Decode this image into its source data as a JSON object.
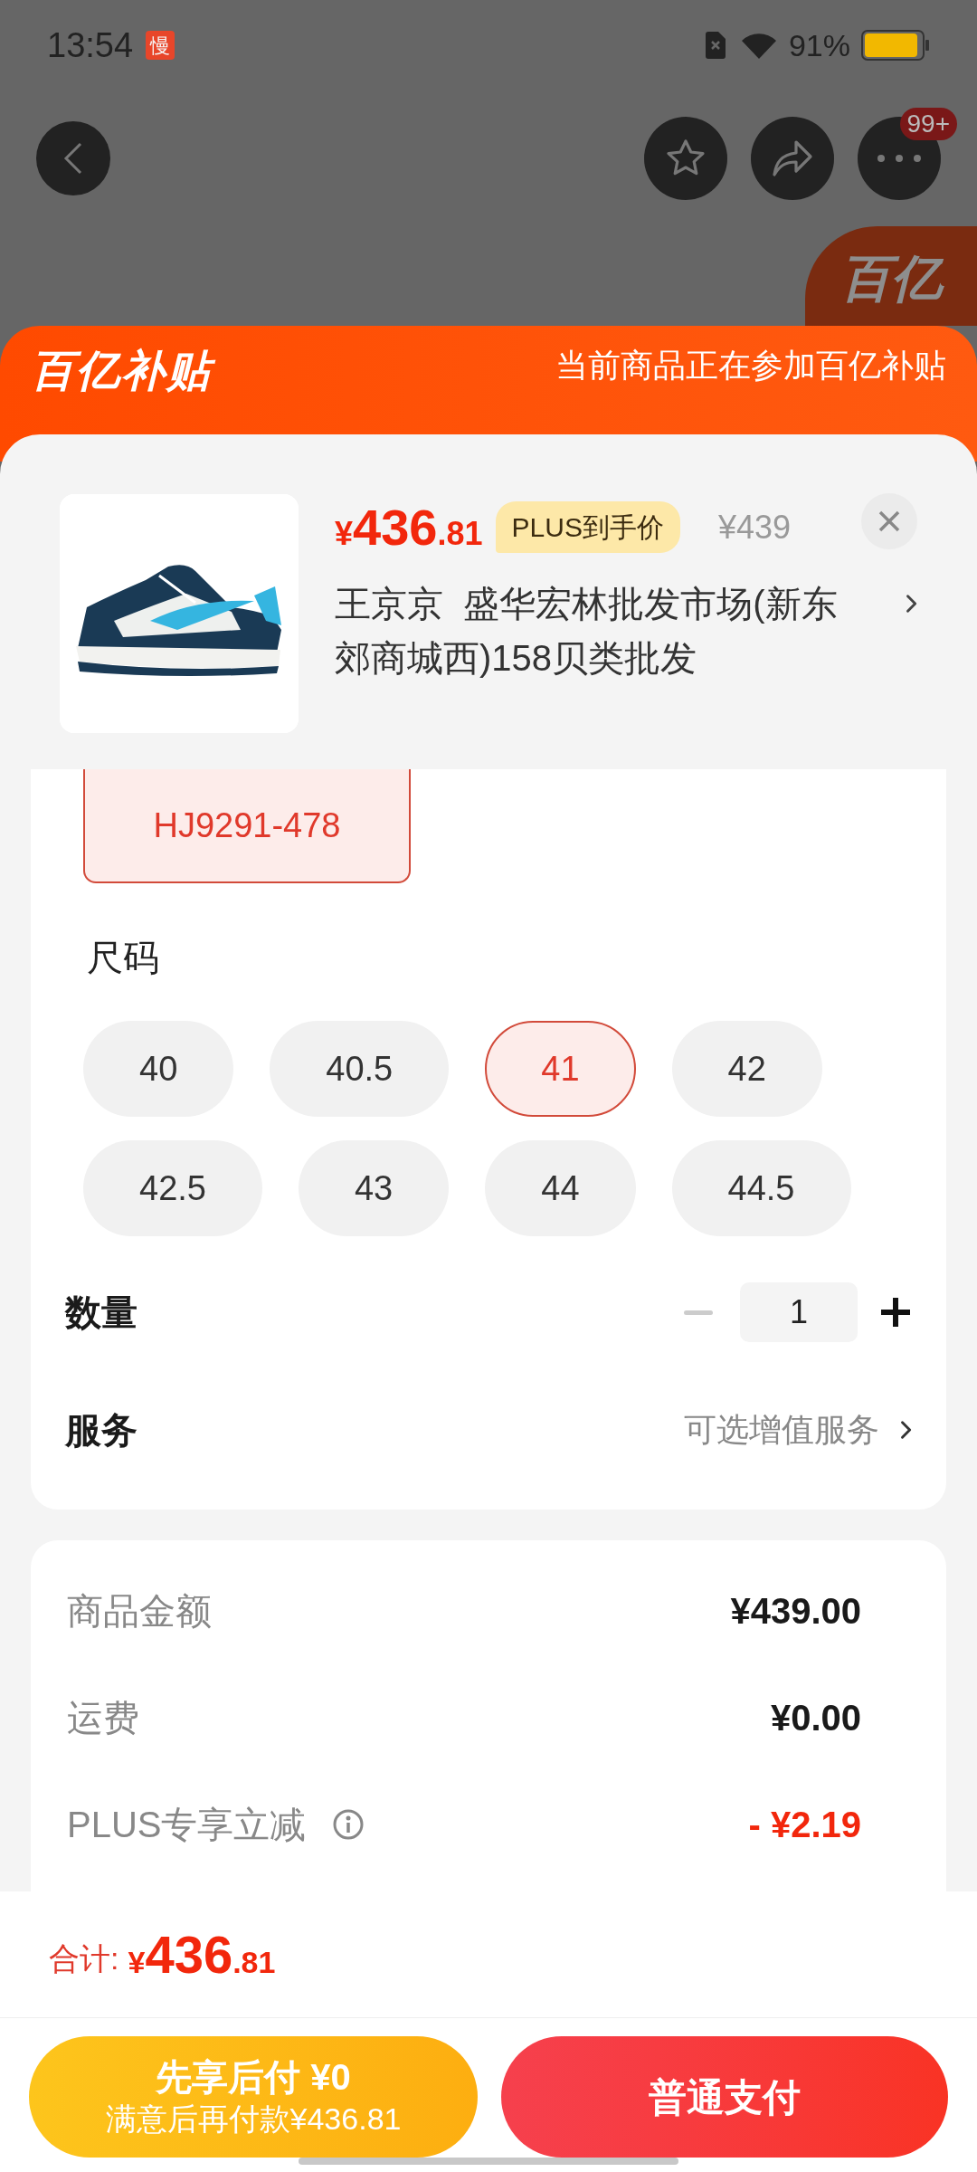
{
  "status_bar": {
    "time": "13:54",
    "app_badge": "慢",
    "battery": "91%"
  },
  "top_bar": {
    "more_badge": "99+"
  },
  "side_badge": {
    "text": "百亿"
  },
  "banner": {
    "logo": "百亿补贴",
    "notice": "当前商品正在参加百亿补贴"
  },
  "product": {
    "price": {
      "currency": "¥",
      "integer": "436",
      "decimal": ".81"
    },
    "price_tag": "PLUS到手价",
    "original_price": "¥439",
    "store": "王京京  盛华宏林批发市场(新东郊商城西)158贝类批发"
  },
  "variant": {
    "label": "HJ9291-478",
    "selected": true
  },
  "size_section": {
    "title": "尺码",
    "sizes": [
      {
        "label": "40",
        "selected": false
      },
      {
        "label": "40.5",
        "selected": false
      },
      {
        "label": "41",
        "selected": true
      },
      {
        "label": "42",
        "selected": false
      },
      {
        "label": "42.5",
        "selected": false
      },
      {
        "label": "43",
        "selected": false
      },
      {
        "label": "44",
        "selected": false
      },
      {
        "label": "44.5",
        "selected": false
      }
    ]
  },
  "quantity": {
    "label": "数量",
    "value": "1",
    "decrease_disabled": true
  },
  "service": {
    "label": "服务",
    "value": "可选增值服务"
  },
  "summary": [
    {
      "label": "商品金额",
      "value": "¥439.00",
      "kind": "normal"
    },
    {
      "label": "运费",
      "value": "¥0.00",
      "kind": "normal"
    },
    {
      "label": "PLUS专享立减",
      "value": "- ¥2.19",
      "kind": "discount"
    }
  ],
  "footer": {
    "total_label": "合计:",
    "total": {
      "currency": "¥",
      "integer": "436",
      "decimal": ".81"
    },
    "pay_later": {
      "title": "先享后付 ¥0",
      "subtitle": "满意后再付款¥436.81"
    },
    "pay_button": "普通支付"
  }
}
